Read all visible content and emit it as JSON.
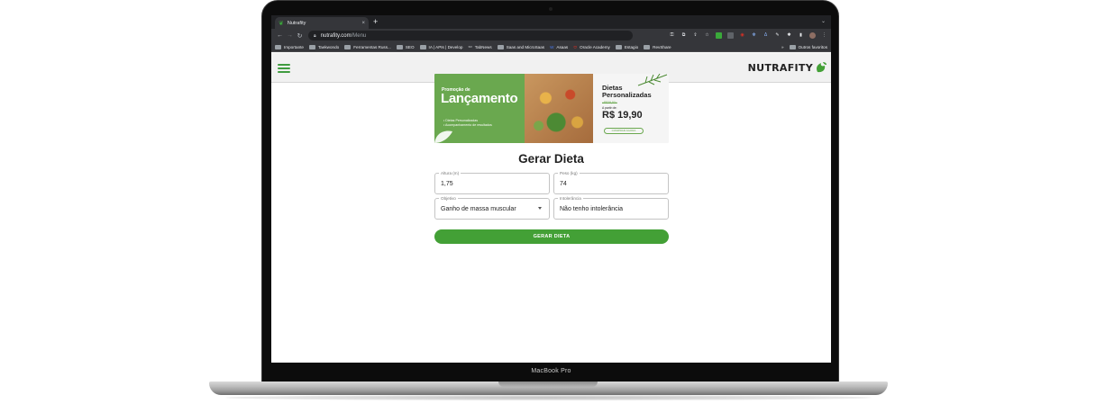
{
  "device": {
    "label": "MacBook Pro"
  },
  "browser": {
    "tab_title": "Nutrafity",
    "tab_close": "×",
    "new_tab": "+",
    "tab_menu": "⌄",
    "url_host": "nutrafity.com",
    "url_path": "/Menu",
    "bookmarks": [
      "Importante",
      "Taekwondo",
      "Ferramentas Russ...",
      "SEO",
      "IA | APIs | Develop",
      "TabNews",
      "Saas and MicroSaas",
      "Asaas",
      "Oracle Academy",
      "Estagio",
      "RevShare"
    ],
    "bookmarks_overflow": "»",
    "bookmarks_other": "Outros favoritos"
  },
  "app": {
    "logo_text": "NUTRAFITY"
  },
  "banner": {
    "promo": "Promoção de",
    "launch": "Lançamento",
    "bullet_1": "• Dietas Personalizadas",
    "bullet_2": "• Acompanhamento de resultados",
    "dietas_1": "Dietas",
    "dietas_2": "Personalizadas",
    "old_price": "~R$39,90~",
    "from": "A partir de:",
    "price": "R$ 19,90",
    "cta": "COMPRAR AGORA"
  },
  "form": {
    "title": "Gerar Dieta",
    "height_label": "Altura (m)",
    "height_value": "1,75",
    "weight_label": "Peso (kg)",
    "weight_value": "74",
    "goal_label": "Objetivo",
    "goal_value": "Ganho de massa muscular",
    "intolerance_label": "Intolerância",
    "intolerance_value": "Não tenho intolerância",
    "submit_label": "GERAR DIETA"
  },
  "colors": {
    "brand_green": "#43a036",
    "banner_green": "#6aa84f"
  }
}
